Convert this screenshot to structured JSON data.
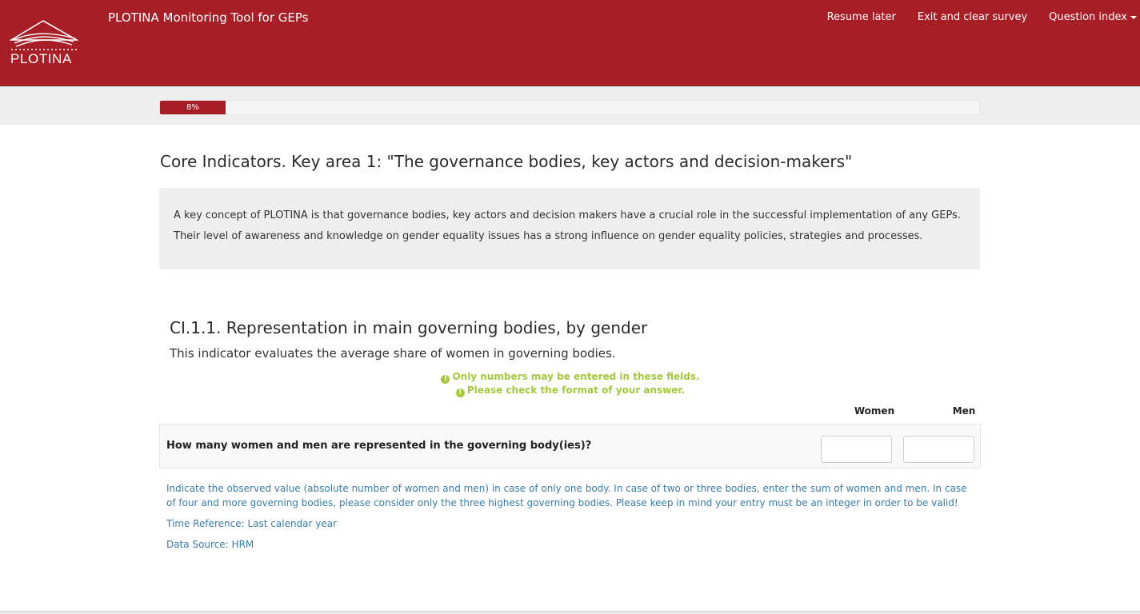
{
  "header": {
    "logo_text": "PLOTINA",
    "app_title": "PLOTINA Monitoring Tool for GEPs",
    "nav": {
      "resume": "Resume later",
      "exit": "Exit and clear survey",
      "index": "Question index"
    }
  },
  "progress": {
    "label": "8%",
    "value_percent": 8
  },
  "group": {
    "title": "Core Indicators. Key area 1: \"The governance bodies, key actors and decision-makers\"",
    "description_line1": "A key concept of PLOTINA is that governance bodies, key actors and decision makers have a crucial role in the successful implementation of any GEPs.",
    "description_line2": "Their level of awareness and knowledge on gender equality issues has a strong influence on gender equality policies, strategies and processes."
  },
  "question": {
    "title": "CI.1.1. Representation in main governing bodies, by gender",
    "subtitle": "This indicator evaluates the average share of women in governing bodies.",
    "tips": [
      "Only numbers may be entered in these fields.",
      "Please check the format of your answer."
    ],
    "columns": [
      "Women",
      "Men"
    ],
    "row_label": "How many women and men are represented in the governing body(ies)?",
    "women_value": "",
    "men_value": "",
    "help_main": "Indicate the observed value (absolute number of women and men) in case of only one body. In case of two or three bodies, enter the sum of women and men. In case of four and more governing bodies, please consider only the three highest governing bodies. Please keep in mind your entry must be an integer in order to be valid!",
    "time_reference": "Time Reference: Last calendar year",
    "data_source": "Data Source: HRM"
  },
  "colors": {
    "brand": "#a81e27",
    "tip": "#a5c83d",
    "help": "#3a7ca5"
  },
  "icons": [
    "logo-roof-icon",
    "exclamation-circle-icon",
    "caret-down-icon"
  ]
}
